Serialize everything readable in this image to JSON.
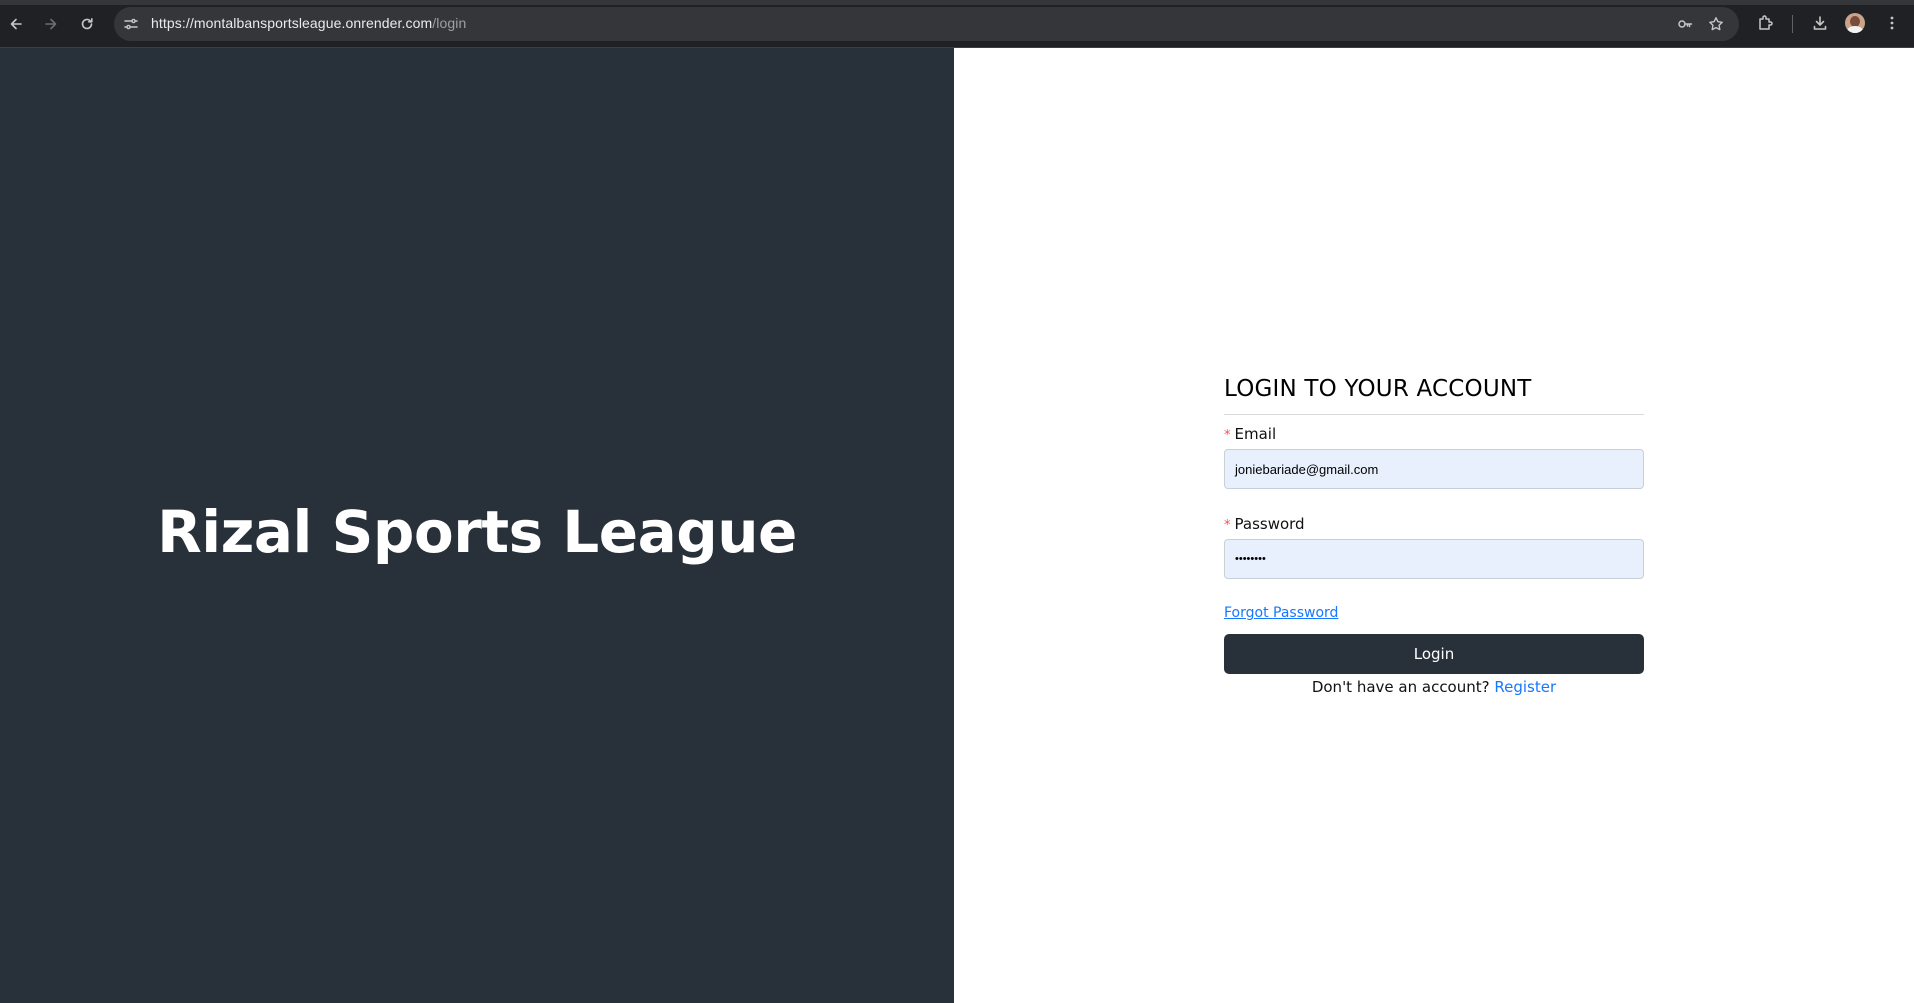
{
  "browser": {
    "url_host": "https://montalbansportsleague.onrender.com",
    "url_path": "/login",
    "icons": [
      "back-icon",
      "forward-icon",
      "reload-icon",
      "site-settings-icon",
      "password-key-icon",
      "bookmark-star-icon",
      "extensions-icon",
      "download-icon",
      "profile-avatar",
      "more-menu-icon"
    ]
  },
  "brand": {
    "title": "Rizal Sports League",
    "background": "#283139"
  },
  "login": {
    "heading": "LOGIN TO YOUR ACCOUNT",
    "required_mark": "*",
    "email_label": "Email",
    "email_value": "joniebariade@gmail.com",
    "password_label": "Password",
    "password_value": "••••••••",
    "forgot_password": "Forgot Password",
    "submit_label": "Login",
    "no_account_text": "Don't have an account?",
    "register_link": "Register",
    "accent_color": "#1677ff",
    "autofill_color": "#e8f0fe"
  }
}
